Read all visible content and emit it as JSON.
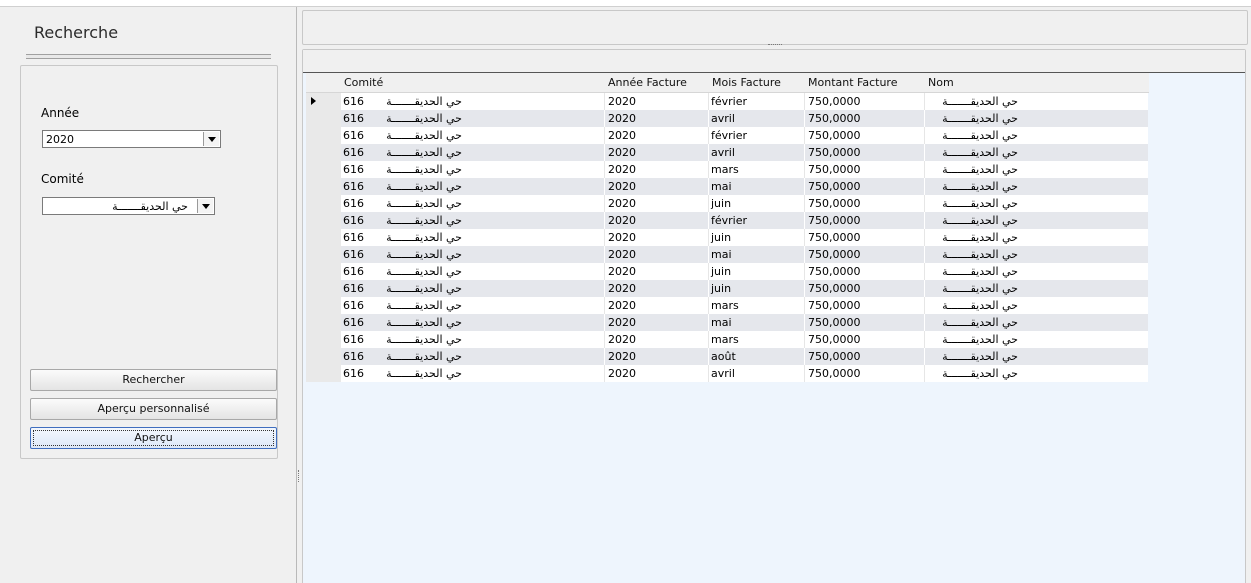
{
  "search": {
    "title": "Recherche",
    "year_label": "Année",
    "year_value": "2020",
    "committee_label": "Comité",
    "committee_value": "حي الحديقـــــــة",
    "buttons": {
      "search": "Rechercher",
      "custom_preview": "Aperçu personnalisé",
      "preview": "Aperçu"
    }
  },
  "grid": {
    "columns": [
      "Comité",
      "Année Facture",
      "Mois Facture",
      "Montant Facture",
      "Nom"
    ],
    "rows": [
      {
        "comite_code": "616",
        "comite_name": "حي الحديقـــــــة",
        "annee": "2020",
        "mois": "février",
        "montant": "750,0000",
        "nom": "حي الحديقـــــــة"
      },
      {
        "comite_code": "616",
        "comite_name": "حي الحديقـــــــة",
        "annee": "2020",
        "mois": "avril",
        "montant": "750,0000",
        "nom": "حي الحديقـــــــة"
      },
      {
        "comite_code": "616",
        "comite_name": "حي الحديقـــــــة",
        "annee": "2020",
        "mois": "février",
        "montant": "750,0000",
        "nom": "حي الحديقـــــــة"
      },
      {
        "comite_code": "616",
        "comite_name": "حي الحديقـــــــة",
        "annee": "2020",
        "mois": "avril",
        "montant": "750,0000",
        "nom": "حي الحديقـــــــة"
      },
      {
        "comite_code": "616",
        "comite_name": "حي الحديقـــــــة",
        "annee": "2020",
        "mois": "mars",
        "montant": "750,0000",
        "nom": "حي الحديقـــــــة"
      },
      {
        "comite_code": "616",
        "comite_name": "حي الحديقـــــــة",
        "annee": "2020",
        "mois": "mai",
        "montant": "750,0000",
        "nom": "حي الحديقـــــــة"
      },
      {
        "comite_code": "616",
        "comite_name": "حي الحديقـــــــة",
        "annee": "2020",
        "mois": "juin",
        "montant": "750,0000",
        "nom": "حي الحديقـــــــة"
      },
      {
        "comite_code": "616",
        "comite_name": "حي الحديقـــــــة",
        "annee": "2020",
        "mois": "février",
        "montant": "750,0000",
        "nom": "حي الحديقـــــــة"
      },
      {
        "comite_code": "616",
        "comite_name": "حي الحديقـــــــة",
        "annee": "2020",
        "mois": "juin",
        "montant": "750,0000",
        "nom": "حي الحديقـــــــة"
      },
      {
        "comite_code": "616",
        "comite_name": "حي الحديقـــــــة",
        "annee": "2020",
        "mois": "mai",
        "montant": "750,0000",
        "nom": "حي الحديقـــــــة"
      },
      {
        "comite_code": "616",
        "comite_name": "حي الحديقـــــــة",
        "annee": "2020",
        "mois": "juin",
        "montant": "750,0000",
        "nom": "حي الحديقـــــــة"
      },
      {
        "comite_code": "616",
        "comite_name": "حي الحديقـــــــة",
        "annee": "2020",
        "mois": "juin",
        "montant": "750,0000",
        "nom": "حي الحديقـــــــة"
      },
      {
        "comite_code": "616",
        "comite_name": "حي الحديقـــــــة",
        "annee": "2020",
        "mois": "mars",
        "montant": "750,0000",
        "nom": "حي الحديقـــــــة"
      },
      {
        "comite_code": "616",
        "comite_name": "حي الحديقـــــــة",
        "annee": "2020",
        "mois": "mai",
        "montant": "750,0000",
        "nom": "حي الحديقـــــــة"
      },
      {
        "comite_code": "616",
        "comite_name": "حي الحديقـــــــة",
        "annee": "2020",
        "mois": "mars",
        "montant": "750,0000",
        "nom": "حي الحديقـــــــة"
      },
      {
        "comite_code": "616",
        "comite_name": "حي الحديقـــــــة",
        "annee": "2020",
        "mois": "août",
        "montant": "750,0000",
        "nom": "حي الحديقـــــــة"
      },
      {
        "comite_code": "616",
        "comite_name": "حي الحديقـــــــة",
        "annee": "2020",
        "mois": "avril",
        "montant": "750,0000",
        "nom": "حي الحديقـــــــة"
      }
    ]
  }
}
